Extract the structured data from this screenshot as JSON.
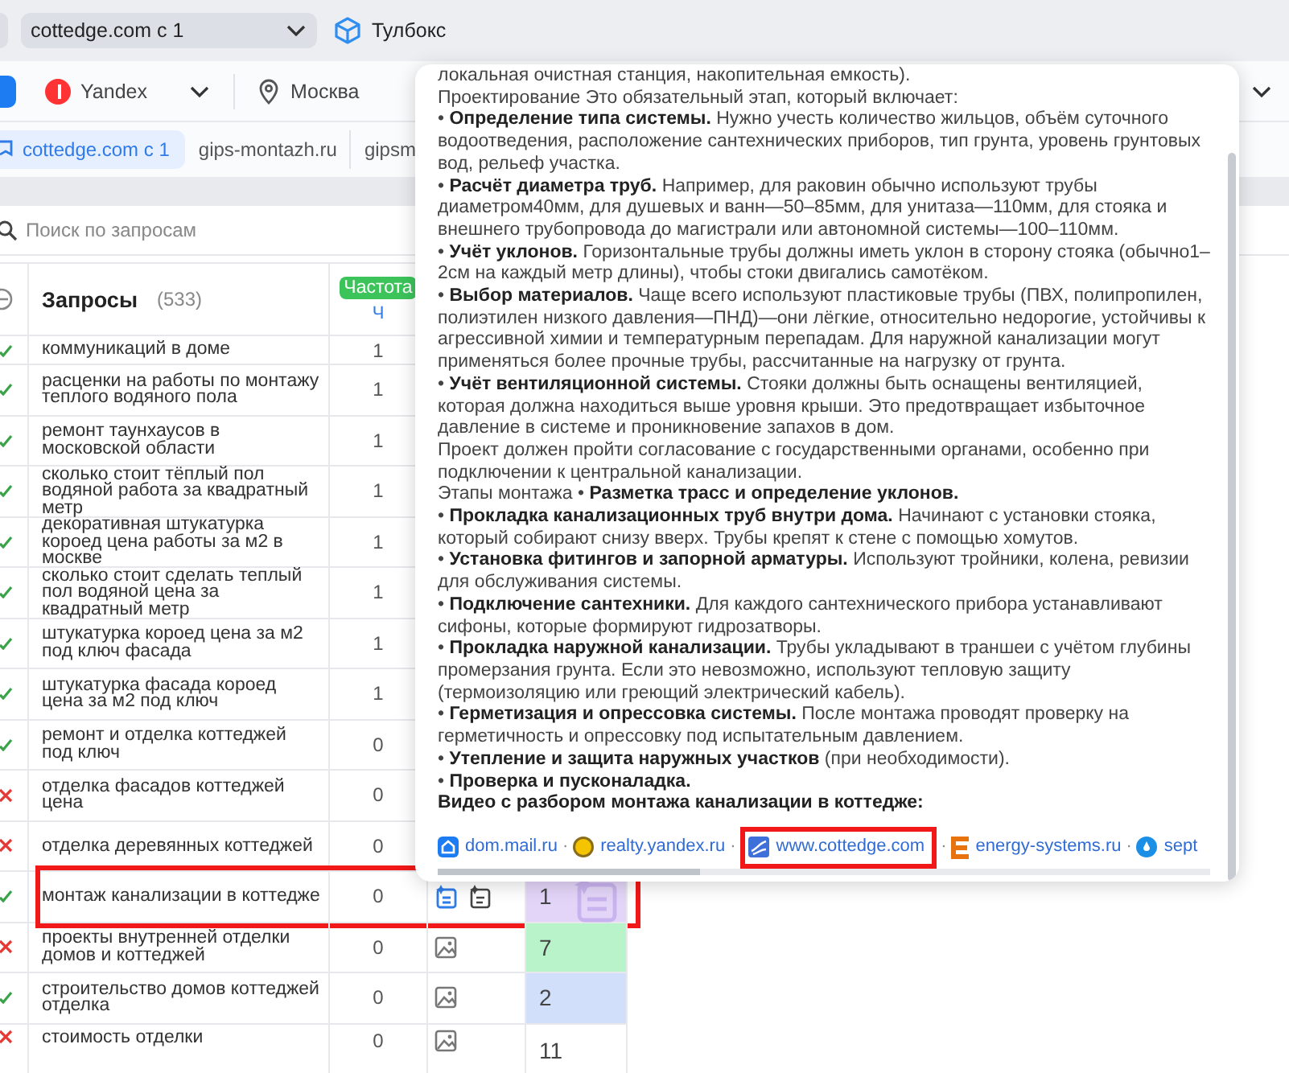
{
  "project_select": {
    "value": "cottedge.com с 1"
  },
  "toolbox": {
    "label": "Тулбокс"
  },
  "engine": {
    "label": "Yandex"
  },
  "region": {
    "label": "Москва"
  },
  "tabs": [
    {
      "label": "cottedge.com с 1",
      "selected": true
    },
    {
      "label": "gips-montazh.ru",
      "selected": false
    },
    {
      "label": "gipsm",
      "selected": false
    }
  ],
  "search": {
    "placeholder": "Поиск по запросам"
  },
  "table": {
    "title": "Запросы",
    "count": "(533)",
    "frequency_badge": "Частота",
    "frequency_sub": "Ч",
    "rows": [
      {
        "query": "коммуникаций в доме",
        "frequency": "1",
        "valid": true,
        "highlighted": false
      },
      {
        "query": "расценки на работы по монтажу теплого водяного пола",
        "frequency": "1",
        "valid": true,
        "highlighted": false
      },
      {
        "query": "ремонт таунхаусов в московской области",
        "frequency": "1",
        "valid": true,
        "highlighted": false
      },
      {
        "query": "сколько стоит тёплый пол водяной работа за квадратный метр",
        "frequency": "1",
        "valid": true,
        "highlighted": false
      },
      {
        "query": "декоративная штукатурка короед цена работы за м2 в москве",
        "frequency": "1",
        "valid": true,
        "highlighted": false
      },
      {
        "query": "сколько стоит сделать теплый пол водяной цена за квадратный метр",
        "frequency": "1",
        "valid": true,
        "highlighted": false
      },
      {
        "query": "штукатурка короед цена за м2 под ключ фасада",
        "frequency": "1",
        "valid": true,
        "highlighted": false
      },
      {
        "query": "штукатурка фасада короед цена за м2 под ключ",
        "frequency": "1",
        "valid": true,
        "highlighted": false
      },
      {
        "query": "ремонт и отделка коттеджей под ключ",
        "frequency": "0",
        "valid": true,
        "highlighted": false
      },
      {
        "query": "отделка фасадов коттеджей цена",
        "frequency": "0",
        "valid": false,
        "highlighted": false
      },
      {
        "query": "отделка деревянных коттеджей",
        "frequency": "0",
        "valid": false,
        "highlighted": false
      },
      {
        "query": "монтаж канализации в коттедже",
        "frequency": "0",
        "valid": true,
        "highlighted": true,
        "kind": "answer",
        "mark": "1",
        "color": "#e3d5f8"
      },
      {
        "query": "проекты внутренней отделки домов и коттеджей",
        "frequency": "0",
        "valid": false,
        "highlighted": false,
        "kind": "image",
        "mark": "7",
        "color": "#b9f3c9"
      },
      {
        "query": "строительство домов коттеджей отделка",
        "frequency": "0",
        "valid": true,
        "highlighted": false,
        "kind": "image",
        "mark": "2",
        "color": "#d2dffb"
      },
      {
        "query": "стоимость отделки",
        "frequency": "0",
        "valid": false,
        "highlighted": false,
        "kind": "image",
        "mark": "11",
        "color": "#ffffff"
      }
    ]
  },
  "answer_popup": {
    "paragraphs": [
      {
        "kind": "text",
        "text": "локальная очистная станция, накопительная емкость)."
      },
      {
        "kind": "text",
        "text": "Проектирование Это обязательный этап, который включает:"
      },
      {
        "kind": "text",
        "text": "• **Определение типа системы.** Нужно учесть количество жильцов, объём суточного водоотведения, расположение сантехнических приборов, тип грунта, уровень грунтовых вод, рельеф участка."
      },
      {
        "kind": "text",
        "text": "• **Расчёт диаметра труб.** Например, для раковин обычно используют трубы диаметром40мм, для душевых и ванн—50–85мм, для унитаза—110мм, для стояка и внешнего трубопровода до магистрали или автономной системы—100–110мм."
      },
      {
        "kind": "text",
        "text": "• **Учёт уклонов.** Горизонтальные трубы должны иметь уклон в сторону стояка (обычно1–2см на каждый метр длины), чтобы стоки двигались самотёком."
      },
      {
        "kind": "text",
        "text": "• **Выбор материалов.** Чаще всего используют пластиковые трубы (ПВХ, полипропилен, полиэтилен низкого давления—ПНД)—они лёгкие, относительно недорогие, устойчивы к агрессивной химии и температурным перепадам. Для наружной канализации могут применяться более прочные трубы, рассчитанные на нагрузку от грунта."
      },
      {
        "kind": "text",
        "text": "• **Учёт вентиляционной системы.** Стояки должны быть оснащены вентиляцией, которая должна находиться выше уровня крыши. Это предотвращает избыточное давление в системе и проникновение запахов в дом."
      },
      {
        "kind": "text",
        "text": "Проект должен пройти согласование с государственными органами, особенно при подключении к центральной канализации."
      },
      {
        "kind": "text",
        "text": "Этапы монтажа • **Разметка трасс и определение уклонов.**"
      },
      {
        "kind": "text",
        "text": "• **Прокладка канализационных труб внутри дома.** Начинают с установки стояка, который собирают снизу вверх. Трубы крепят к стене с помощью хомутов."
      },
      {
        "kind": "text",
        "text": "• **Установка фитингов и запорной арматуры.** Используют тройники, колена, ревизии для обслуживания системы."
      },
      {
        "kind": "text",
        "text": "• **Подключение сантехники.** Для каждого сантехнического прибора устанавливают сифоны, которые формируют гидрозатворы."
      },
      {
        "kind": "text",
        "text": "• **Прокладка наружной канализации.** Трубы укладывают в траншеи с учётом глубины промерзания грунта. Если это невозможно, используют тепловую защиту (термоизоляцию или греющий электрический кабель)."
      },
      {
        "kind": "text",
        "text": "• **Герметизация и опрессовка системы.** После монтажа проводят проверку на герметичность и опрессовку под испытательным давлением."
      },
      {
        "kind": "text",
        "text": "• **Утепление и защита наружных участков** (при необходимости)."
      },
      {
        "kind": "text",
        "text": "• **Проверка и пусконаладка.**"
      },
      {
        "kind": "heading",
        "text": "Видео с разбором монтажа канализации в коттедже:"
      }
    ],
    "sources": [
      {
        "kind": "house",
        "label": "dom.mail.ru",
        "highlighted": false
      },
      {
        "separator": "·",
        "kind": "coin",
        "label": "realty.yandex.ru",
        "highlighted": false
      },
      {
        "separator": "·",
        "kind": "site",
        "label": "www.cottedge.com",
        "highlighted": true
      },
      {
        "separator": "·",
        "kind": "letter",
        "label": "energy-systems.ru",
        "highlighted": false
      },
      {
        "separator": "·",
        "kind": "drop",
        "label": "sept",
        "highlighted": false
      }
    ]
  }
}
